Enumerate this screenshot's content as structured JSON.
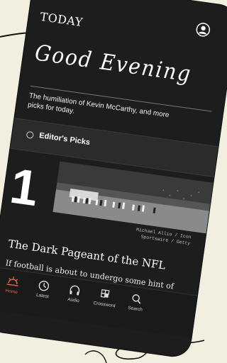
{
  "app": {
    "logo": "TODAY"
  },
  "header": {
    "greeting": "Good Evening"
  },
  "intro": {
    "subtitle": "The humiliation of Kevin McCarthy, and more picks for today."
  },
  "picks": {
    "label": "Editor's Picks"
  },
  "story": {
    "rank": "1",
    "photo_credit_line1": "Michael Allio / Icon",
    "photo_credit_line2": "Sportswire / Getty",
    "headline": "The Dark Pageant of the NFL",
    "lede": "If football is about to undergo some hint of"
  },
  "nav": {
    "items": [
      {
        "label": "Home",
        "icon": "sunrise-icon",
        "active": true
      },
      {
        "label": "Latest",
        "icon": "clock-icon"
      },
      {
        "label": "Audio",
        "icon": "headphones-icon"
      },
      {
        "label": "Crossword",
        "icon": "crossword-icon"
      },
      {
        "label": "Search",
        "icon": "search-icon"
      }
    ]
  },
  "colors": {
    "background": "#f1efdf",
    "phone": "#1d1d1d",
    "accent": "#e0624a"
  }
}
